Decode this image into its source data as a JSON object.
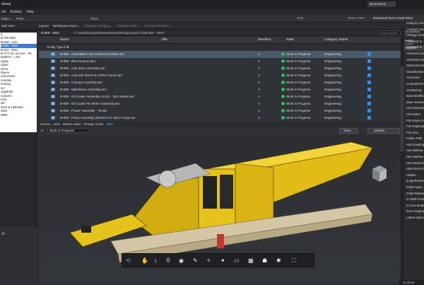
{
  "titlebar": {
    "title": "sional",
    "user": "Bruce Buck",
    "help": "Help",
    "share": "Share View",
    "download": "Download from Cloud Drive"
  },
  "menu": [
    "ols",
    "Actions",
    "Help"
  ],
  "toolbar1": [
    "Repo...",
    "Print...",
    "Find..."
  ],
  "toolbar2": {
    "left": "ault View",
    "items": [
      "Layout",
      "Workspace Sync...",
      "Change Category...",
      "Change State...",
      "Change Revision..."
    ]
  },
  "path": {
    "folder": "B-809 - DMJ",
    "full": "C:\\Vault\\Designs\\Mastenbrand\\Workgroups\\CT\\1\\B-809 - DMJ\\",
    "search": "Search B-809..."
  },
  "columns": {
    "name": "Name",
    "title": "Title",
    "revision": "Revision",
    "state": "State",
    "category": "Category Name"
  },
  "group": "Entity Type:File",
  "rows": [
    {
      "name": "B-809 - ASSEMBLY MACHINE SCHEME.iam",
      "rev": "A",
      "state": "Work in Progress",
      "cat": "Engineering"
    },
    {
      "name": "B-809 - Blue Beacon.iam",
      "rev": "A",
      "state": "Work in Progress",
      "cat": "Engineering"
    },
    {
      "name": "B-809 - Cab Seat Assembly.iam",
      "rev": "A",
      "state": "Work in Progress",
      "cat": "Engineering"
    },
    {
      "name": "B-809 - Cab with ROPS & FOPS Frame.iam",
      "rev": "A",
      "state": "Work in Progress",
      "cat": "Engineering"
    },
    {
      "name": "B-809 - Canopy Assembly.iam",
      "rev": "A",
      "state": "Work in Progress",
      "cat": "Engineering"
    },
    {
      "name": "B-809 - Mainframe Assembly.iam",
      "rev": "A",
      "state": "Work in Progress",
      "cat": "Engineering"
    },
    {
      "name": "B-809 - Oil Cooler Assembly A1102 - 2hcc Motor.iam",
      "rev": "A",
      "state": "Work in Progress",
      "cat": "Engineering"
    },
    {
      "name": "B-809 - Oil Cooler Fly Mesh Assembly.iam",
      "rev": "A",
      "state": "Work in Progress",
      "cat": "Engineering"
    },
    {
      "name": "B-809 - Power Assembly - 75.iam",
      "rev": "A",
      "state": "Work in Progress",
      "cat": "Engineering"
    },
    {
      "name": "B-809 - Pump Assembly (Electric) inc 60cc Pump.iam",
      "rev": "A",
      "state": "Work in Progress",
      "cat": "Engineering"
    }
  ],
  "viewtabs": [
    "History",
    "Uses",
    "Where Used",
    "Change Order",
    "View"
  ],
  "statebar": {
    "prefix": "A",
    "state": "Work in Progress",
    "view_btn": "View...",
    "update_btn": "Update..."
  },
  "lefttree": [
    "d",
    "B-760 DMJ",
    "B-808 - LDC",
    "B-809 - DMJ",
    "B-812 - DMJ",
    "B-YYY Do not use - Pe",
    "M29071 - LDC",
    "nging",
    "",
    "ngine",
    "ssets",
    "Eaves",
    "ural Drives",
    "nnentse",
    "",
    "ressing",
    "ion",
    "oyglands",
    "ructures",
    "erse",
    "ulic",
    "ation & Hydraulic",
    "",
    "2021",
    "9500"
  ],
  "leftbottom": "rd",
  "props": {
    "header": "properties",
    "path": "B-809 - ASSE",
    "group": "System",
    "items": [
      "Category Na",
      "Category Na",
      "Change Orde",
      "Checked In",
      "Checked In",
      "Checked Out",
      "Checked Out",
      "Checked Out",
      "Classification",
      "Comment",
      "Controlled B",
      "Created By",
      "Data Modifie",
      "Date Version",
      "File Extensio",
      "File Name",
      "File Name (H",
      "File Replicati",
      "File Size",
      "Folder Path",
      "Has Drawing",
      "Has Markup",
      "Has Markup",
      "Has Model S",
      "Has Parent R",
      "Hidden",
      "iLogicRuleSt",
      "Initial Appro",
      "Initial Releas",
      "Is Table Drive",
      "Is True Mode",
      "Item Assignat",
      "Latest Appro"
    ]
  },
  "status": "localhost",
  "colors": {
    "accent": "#3e7cc7",
    "machine": "#e8c31a",
    "state_ok": "#2dbb5b"
  }
}
